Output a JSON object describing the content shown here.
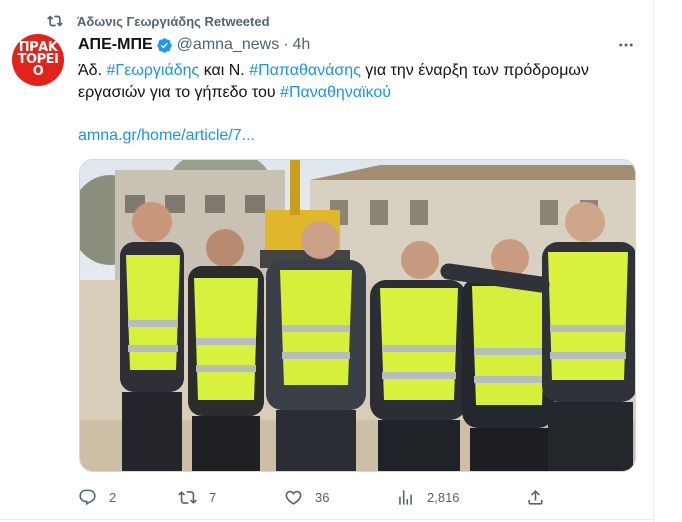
{
  "retweet_context": {
    "text": "Άδωνις Γεωργιάδης Retweeted",
    "icon": "retweet-icon"
  },
  "author": {
    "avatar_text": "ΠΡΑΚΤΟΡΕΙΟ",
    "name": "ΑΠΕ-ΜΠΕ",
    "verified_icon": "verified-badge-icon",
    "handle": "@amna_news",
    "separator": "·",
    "time": "4h"
  },
  "more_icon": "more-horizontal-icon",
  "tweet": {
    "parts": [
      {
        "t": "text",
        "v": "Άδ. "
      },
      {
        "t": "tag",
        "v": "#Γεωργιάδης"
      },
      {
        "t": "text",
        "v": " και Ν. "
      },
      {
        "t": "tag",
        "v": "#Παπαθανάσης"
      },
      {
        "t": "text",
        "v": " για την έναρξη των πρόδρομων εργασιών για το γήπεδο του "
      },
      {
        "t": "tag",
        "v": "#Παναθηναϊκού"
      }
    ],
    "link_text": "amna.gr/home/article/7..."
  },
  "photo": {
    "icon": "photo-men-in-safety-vests"
  },
  "actions": {
    "reply_count": "2",
    "retweet_count": "7",
    "like_count": "36",
    "views_count": "2,816"
  },
  "colors": {
    "link": "#1b95e0",
    "secondary_text": "#536471",
    "verified": "#1d9bf0",
    "avatar_red": "#e2231a"
  }
}
